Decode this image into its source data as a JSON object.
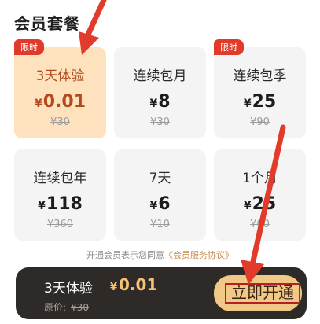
{
  "section_title": "会员套餐",
  "plans": [
    {
      "tag": "限时",
      "name": "3天体验",
      "currency": "¥",
      "price": "0.01",
      "original": "¥30",
      "selected": true
    },
    {
      "tag": "",
      "name": "连续包月",
      "currency": "¥",
      "price": "8",
      "original": "¥30",
      "selected": false
    },
    {
      "tag": "限时",
      "name": "连续包季",
      "currency": "¥",
      "price": "25",
      "original": "¥90",
      "selected": false
    },
    {
      "tag": "",
      "name": "连续包年",
      "currency": "¥",
      "price": "118",
      "original": "¥360",
      "selected": false
    },
    {
      "tag": "",
      "name": "7天",
      "currency": "¥",
      "price": "6",
      "original": "¥10",
      "selected": false
    },
    {
      "tag": "",
      "name": "1个月",
      "currency": "¥",
      "price": "25",
      "original": "¥60",
      "selected": false
    }
  ],
  "agreement": {
    "text": "开通会员表示您同意",
    "link": "《会员服务协议》"
  },
  "checkout": {
    "selected_name": "3天体验",
    "currency": "¥",
    "price": "0.01",
    "original_label": "原价:",
    "original_value": "¥30",
    "button_label": "立即开通"
  },
  "colors": {
    "accent": "#e03a2a",
    "selected_bg": "#fde2bd",
    "bar_bg": "#2d2a28",
    "button_bg": "#f2c887"
  }
}
